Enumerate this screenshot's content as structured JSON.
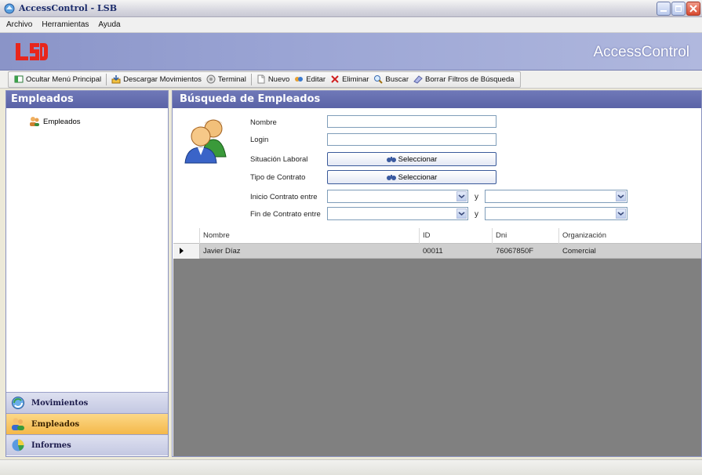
{
  "window": {
    "title": "AccessControl - LSB"
  },
  "menu": {
    "items": [
      "Archivo",
      "Herramientas",
      "Ayuda"
    ]
  },
  "banner": {
    "logo": "LSB",
    "brand": "AccessControl"
  },
  "toolbar": {
    "hide_menu": "Ocultar Menú Principal",
    "download": "Descargar Movimientos",
    "terminal": "Terminal",
    "new": "Nuevo",
    "edit": "Editar",
    "delete": "Eliminar",
    "search": "Buscar",
    "clear_filters": "Borrar Filtros de Búsqueda"
  },
  "sidebar": {
    "header": "Empleados",
    "tree_item": "Empleados",
    "nav": [
      {
        "label": "Movimientos",
        "icon": "movements-icon",
        "active": false
      },
      {
        "label": "Empleados",
        "icon": "employees-icon",
        "active": true
      },
      {
        "label": "Informes",
        "icon": "reports-icon",
        "active": false
      }
    ]
  },
  "search_panel": {
    "header": "Búsqueda de Empleados",
    "nombre_label": "Nombre",
    "nombre_value": "",
    "login_label": "Login",
    "login_value": "",
    "situacion_label": "Situación Laboral",
    "situacion_button": "Seleccionar",
    "tipo_label": "Tipo de Contrato",
    "tipo_button": "Seleccionar",
    "inicio_label": "Inicio Contrato entre",
    "fin_label": "Fin de Contrato entre",
    "y_label": "y"
  },
  "grid": {
    "columns": [
      "Nombre",
      "ID",
      "Dni",
      "Organización"
    ],
    "rows": [
      {
        "nombre": "Javier Díaz",
        "id": "00011",
        "dni": "76067850F",
        "organizacion": "Comercial"
      }
    ]
  },
  "colors": {
    "header": "#5a63a6",
    "active_nav": "#f4b84a",
    "grid_bg": "#808080"
  }
}
